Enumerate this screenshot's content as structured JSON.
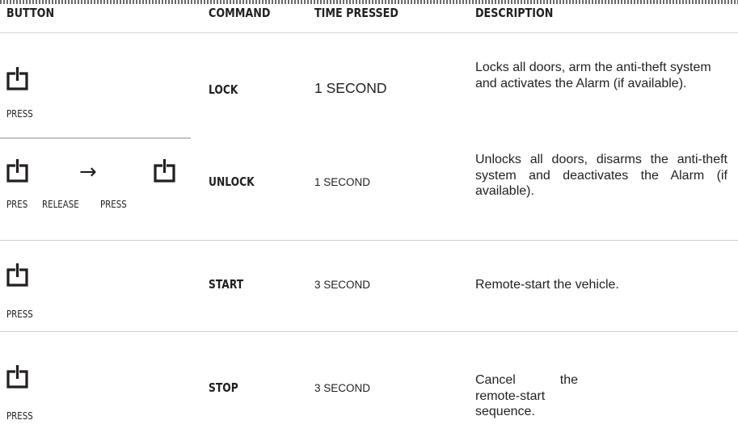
{
  "table": {
    "headers": {
      "button": "BUTTON",
      "command": "COMMAND",
      "time_pressed": "TIME PRESSED",
      "description": "DESCRIPTION"
    },
    "rows": [
      {
        "icon": "power-button-icon",
        "press_label": "PRESS",
        "command": "LOCK",
        "time": "1 SECOND",
        "description": "Locks all doors, arm the anti-theft system and activates the Alarm (if available)."
      },
      {
        "icon": "power-button-icon",
        "arrow_icon": "arrow-right-icon",
        "press_label_1": "PRES",
        "release_label": "RELEASE",
        "press_label_2": "PRESS",
        "command": "UNLOCK",
        "time": "1 SECOND",
        "description": "Unlocks all doors, disarms the anti-theft system and deactivates the Alarm (if available)."
      },
      {
        "icon": "power-button-icon",
        "press_label": "PRESS",
        "command": "START",
        "time": "3 SECOND",
        "description": "Remote-start the vehicle."
      },
      {
        "icon": "power-button-icon",
        "press_label": "PRESS",
        "command": "STOP",
        "time": "3 SECOND",
        "description": "Cancel the remote-start sequence."
      }
    ]
  },
  "colors": {
    "text": "#231f20",
    "divider": "#c4c4c4",
    "header_rule": "#d8d8d8"
  }
}
